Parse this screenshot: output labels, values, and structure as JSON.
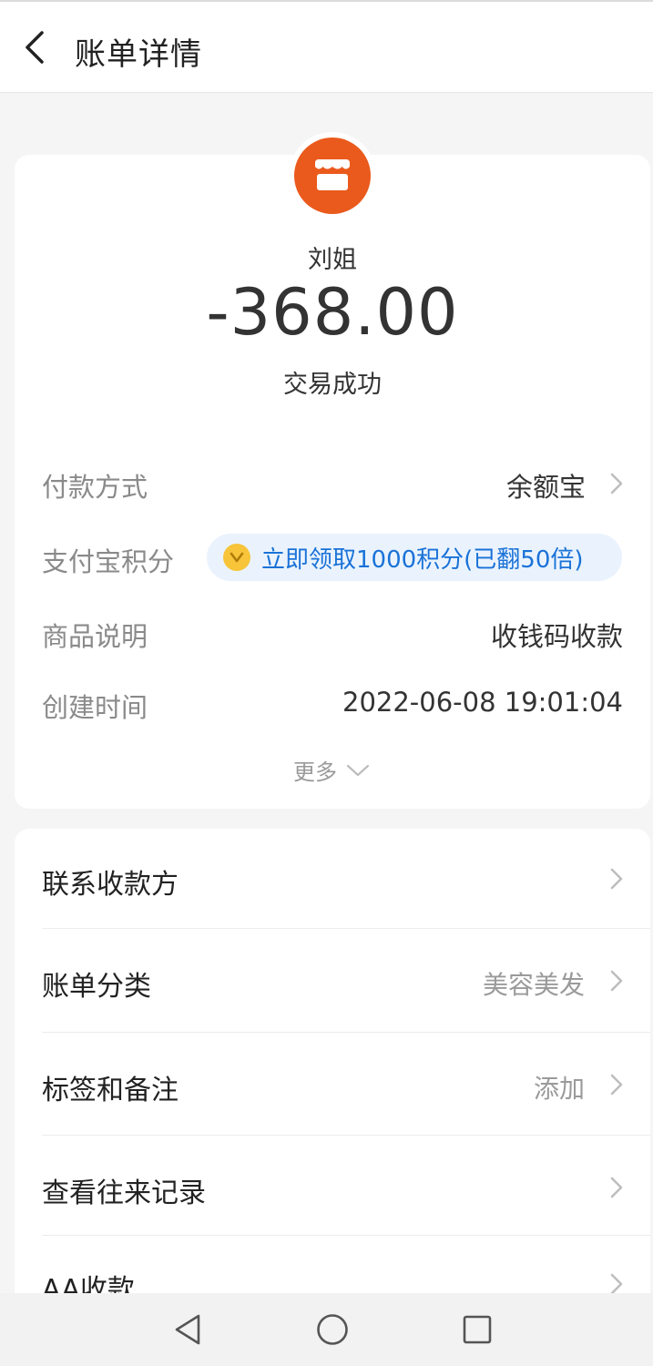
{
  "header": {
    "title": "账单详情"
  },
  "merchant": {
    "name": "刘姐",
    "amount": "-368.00",
    "status": "交易成功"
  },
  "details": {
    "payment_method_label": "付款方式",
    "payment_method_value": "余额宝",
    "points_label": "支付宝积分",
    "points_value": "立即领取1000积分(已翻50倍)",
    "product_label": "商品说明",
    "product_value": "收钱码收款",
    "created_label": "创建时间",
    "created_value": "2022-06-08 19:01:04",
    "more_label": "更多"
  },
  "actions": [
    {
      "label": "联系收款方",
      "value": ""
    },
    {
      "label": "账单分类",
      "value": "美容美发"
    },
    {
      "label": "标签和备注",
      "value": "添加"
    },
    {
      "label": "查看往来记录",
      "value": ""
    },
    {
      "label": "AA收款",
      "value": ""
    }
  ],
  "colors": {
    "accent_orange": "#ea5a1c",
    "points_blue": "#1a72d8",
    "points_pill_bg": "#eaf3fd",
    "coin_yellow": "#f7c43a"
  },
  "icons": {
    "back": "chevron-left-icon",
    "merchant": "shop-icon",
    "nav_back": "triangle-back-icon",
    "nav_home": "circle-home-icon",
    "nav_recent": "square-recent-icon"
  }
}
